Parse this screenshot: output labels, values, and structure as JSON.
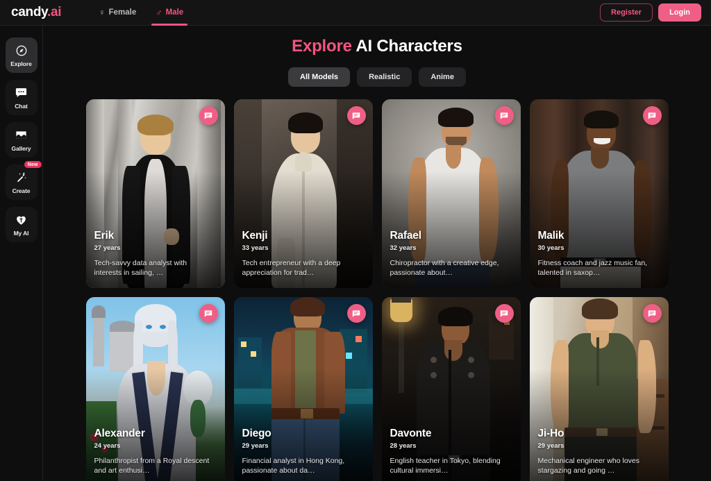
{
  "brand": {
    "name": "candy",
    "suffix": ".ai",
    "accent": "#f2557f"
  },
  "topbar": {
    "tabs": [
      {
        "label": "Female",
        "icon": "female-icon",
        "glyph": "♀",
        "active": false
      },
      {
        "label": "Male",
        "icon": "male-icon",
        "glyph": "♂",
        "active": true
      }
    ],
    "register_label": "Register",
    "login_label": "Login"
  },
  "sidebar": {
    "items": [
      {
        "label": "Explore",
        "icon": "compass-icon",
        "active": true,
        "badge": ""
      },
      {
        "label": "Chat",
        "icon": "chat-bubble-icon",
        "active": false,
        "badge": ""
      },
      {
        "label": "Gallery",
        "icon": "gallery-image-icon",
        "active": false,
        "badge": ""
      },
      {
        "label": "Create",
        "icon": "magic-wand-icon",
        "active": false,
        "badge": "New"
      },
      {
        "label": "My AI",
        "icon": "heart-icon",
        "active": false,
        "badge": ""
      }
    ]
  },
  "main": {
    "title_accent": "Explore",
    "title_rest": " AI Characters",
    "filters": [
      {
        "label": "All Models",
        "active": true
      },
      {
        "label": "Realistic",
        "active": false
      },
      {
        "label": "Anime",
        "active": false
      }
    ],
    "cards": [
      {
        "name": "Erik",
        "age": "27 years",
        "desc": "Tech-savvy data analyst with interests in sailing, …"
      },
      {
        "name": "Kenji",
        "age": "33 years",
        "desc": "Tech entrepreneur with a deep appreciation for trad…"
      },
      {
        "name": "Rafael",
        "age": "32 years",
        "desc": "Chiropractor with a creative edge, passionate about…"
      },
      {
        "name": "Malik",
        "age": "30 years",
        "desc": "Fitness coach and jazz music fan, talented in saxop…"
      },
      {
        "name": "Alexander",
        "age": "24 years",
        "desc": "Philanthropist from a Royal descent and art enthusi…"
      },
      {
        "name": "Diego",
        "age": "29 years",
        "desc": "Financial analyst in Hong Kong, passionate about da…"
      },
      {
        "name": "Davonte",
        "age": "28 years",
        "desc": "English teacher in Tokyo, blending cultural immersi…"
      },
      {
        "name": "Ji-Ho",
        "age": "29 years",
        "desc": "Mechanical engineer who loves stargazing and going …"
      }
    ],
    "card_action_icon": "chat-bubble-icon"
  }
}
